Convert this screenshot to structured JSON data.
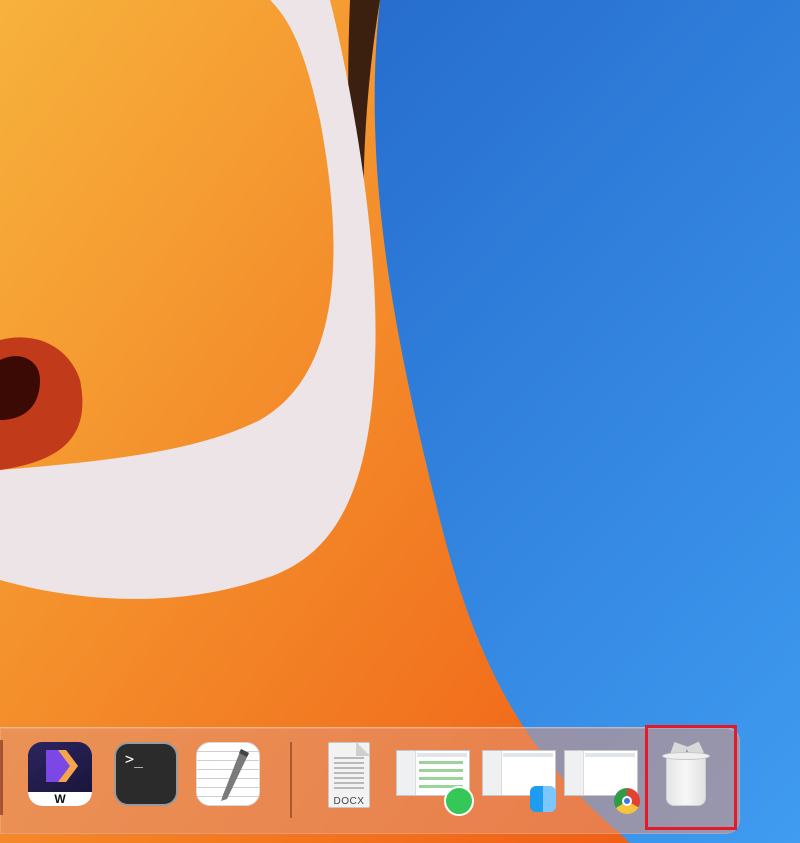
{
  "dock": {
    "items": [
      {
        "id": "filmora",
        "glyph": "W"
      },
      {
        "id": "terminal",
        "prompt": ">_"
      },
      {
        "id": "textedit"
      },
      {
        "id": "document",
        "type_label": "DOCX"
      },
      {
        "id": "whatsapp-window"
      },
      {
        "id": "finder-window"
      },
      {
        "id": "chrome-window"
      },
      {
        "id": "trash"
      }
    ]
  },
  "colors": {
    "highlight": "#e31a2a",
    "wallpaper_blue": "#2f7fe0",
    "wallpaper_orange": "#f4781d"
  }
}
